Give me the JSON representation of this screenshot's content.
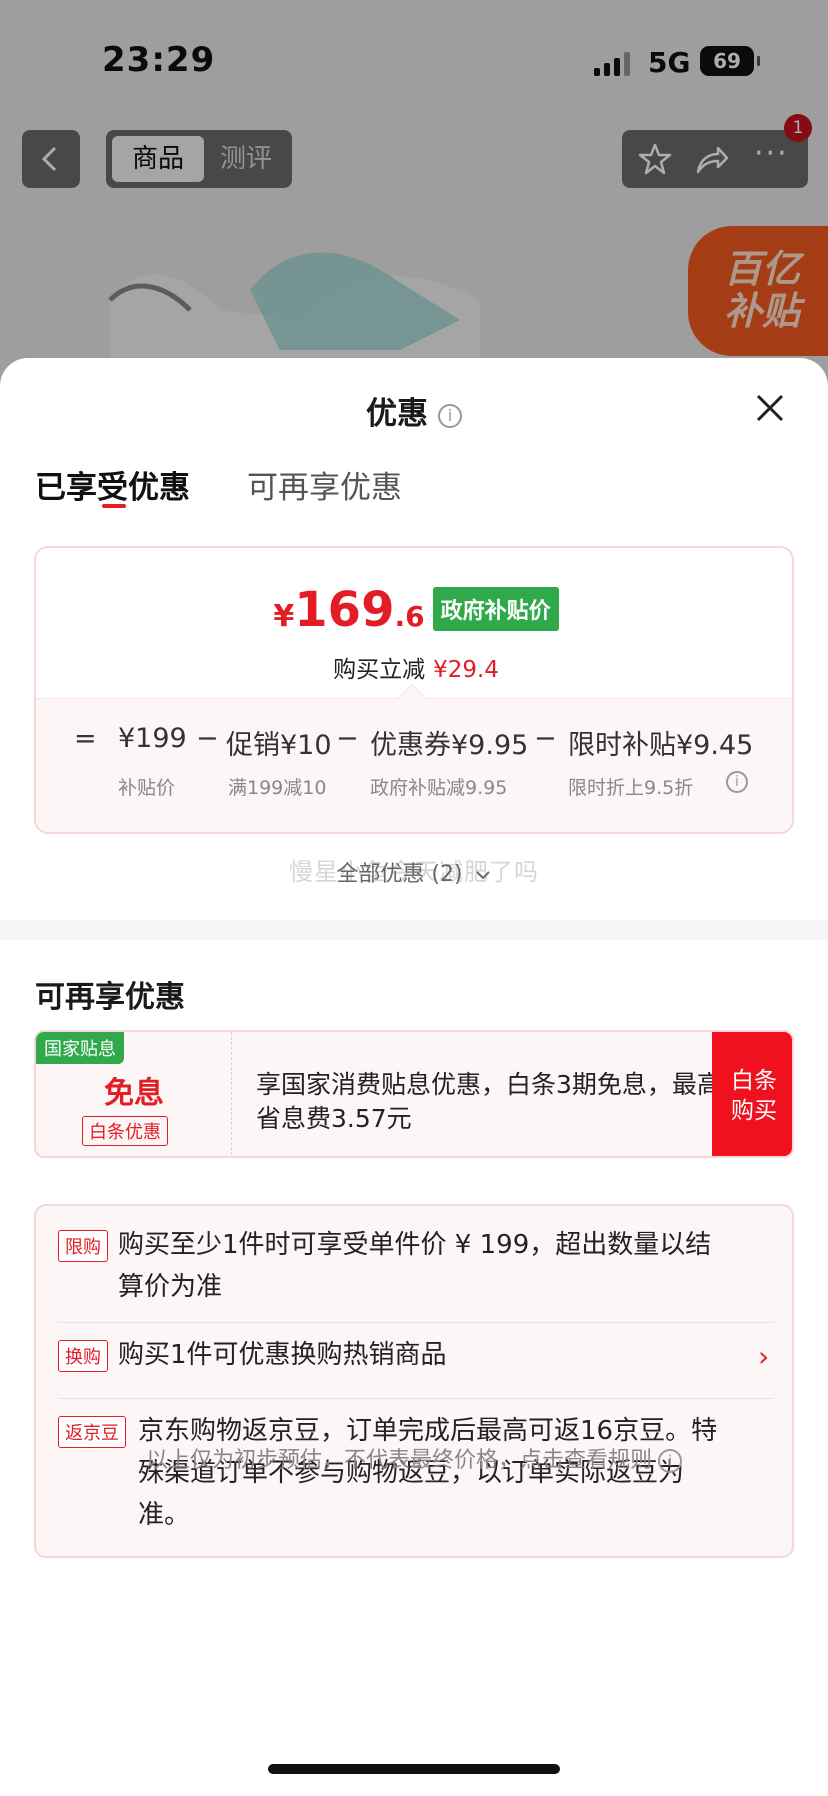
{
  "status_bar": {
    "time": "23:29",
    "network": "5G",
    "battery": "69"
  },
  "nav": {
    "back_icon": "chevron-left-icon",
    "tabs": [
      "商品",
      "测评"
    ],
    "badge": "1",
    "icons": [
      "star-icon",
      "share-icon",
      "more-icon"
    ]
  },
  "banner": {
    "line1": "百亿",
    "line2": "补贴"
  },
  "sheet": {
    "title": "优惠",
    "tabs": [
      "已享受优惠",
      "可再享优惠"
    ],
    "price": {
      "currency": "¥",
      "integer": "169",
      "decimal": ".6",
      "gov_tag": "政府补贴价",
      "reduce_label": "购买立减",
      "reduce_amount": "¥29.4"
    },
    "breakdown": [
      {
        "op": "=",
        "amount": "¥199",
        "sub": "补贴价"
      },
      {
        "op": "−",
        "amount": "促销¥10",
        "sub": "满199减10"
      },
      {
        "op": "−",
        "amount": "优惠券¥9.95",
        "sub": "政府补贴减9.95"
      },
      {
        "op": "−",
        "amount": "限时补贴¥9.45",
        "sub": "限时折上9.5折"
      }
    ],
    "all_promos": "全部优惠 (2)",
    "watermark": "慢星小鱼今天减肥了吗",
    "section_title": "可再享优惠",
    "interest": {
      "badge": "国家贴息",
      "title": "免息",
      "tag": "白条优惠",
      "text": "享国家消费贴息优惠，白条3期免息，最高省息费3.57元",
      "button": "白条购买"
    },
    "promos": [
      {
        "tag": "限购",
        "text": "购买至少1件时可享受单件价 ¥ 199，超出数量以结算价为准"
      },
      {
        "tag": "换购",
        "text": "购买1件可优惠换购热销商品"
      },
      {
        "tag": "返京豆",
        "text": "京东购物返京豆，订单完成后最高可返16京豆。特殊渠道订单不参与购物返豆，以订单实际返豆为准。"
      }
    ],
    "footer_note": "以上仅为初步预估，不代表最终价格，点击查看规则"
  }
}
